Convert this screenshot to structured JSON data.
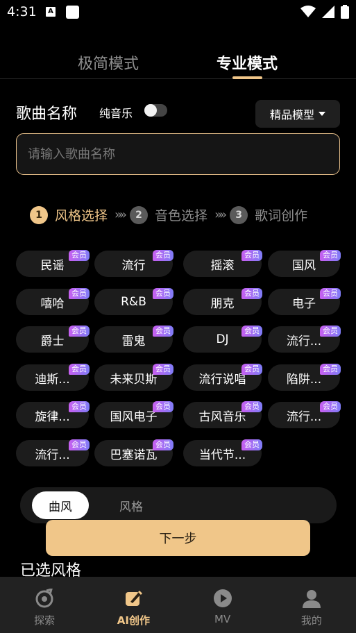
{
  "status": {
    "time": "4:31",
    "a_icon": "A"
  },
  "mode_tabs": {
    "simple": "极简模式",
    "pro": "专业模式"
  },
  "song": {
    "title": "歌曲名称",
    "pure_music_label": "纯音乐",
    "model_select": "精品模型",
    "input_placeholder": "请输入歌曲名称"
  },
  "steps": [
    {
      "num": "1",
      "label": "风格选择"
    },
    {
      "num": "2",
      "label": "音色选择"
    },
    {
      "num": "3",
      "label": "歌词创作"
    }
  ],
  "badge_text": "会员",
  "genres": [
    "民谣",
    "流行",
    "摇滚",
    "国风",
    "嘻哈",
    "R&B",
    "朋克",
    "电子",
    "爵士",
    "雷鬼",
    "DJ",
    "流行...",
    "迪斯...",
    "未来贝斯",
    "流行说唱",
    "陷阱...",
    "旋律...",
    "国风电子",
    "古风音乐",
    "流行...",
    "流行...",
    "巴塞诺瓦",
    "当代节..."
  ],
  "sub_tabs": {
    "active": "曲风",
    "inactive": "风格"
  },
  "next_button": "下一步",
  "selected_style_title": "已选风格",
  "nav": [
    {
      "label": "探索",
      "icon": "explore-icon"
    },
    {
      "label": "AI创作",
      "icon": "ai-create-icon"
    },
    {
      "label": "MV",
      "icon": "play-icon"
    },
    {
      "label": "我的",
      "icon": "user-icon"
    }
  ],
  "colors": {
    "accent": "#f0c689",
    "badge_start": "#c85ff0",
    "badge_end": "#7f7cf7",
    "nav_bg": "#222222"
  }
}
